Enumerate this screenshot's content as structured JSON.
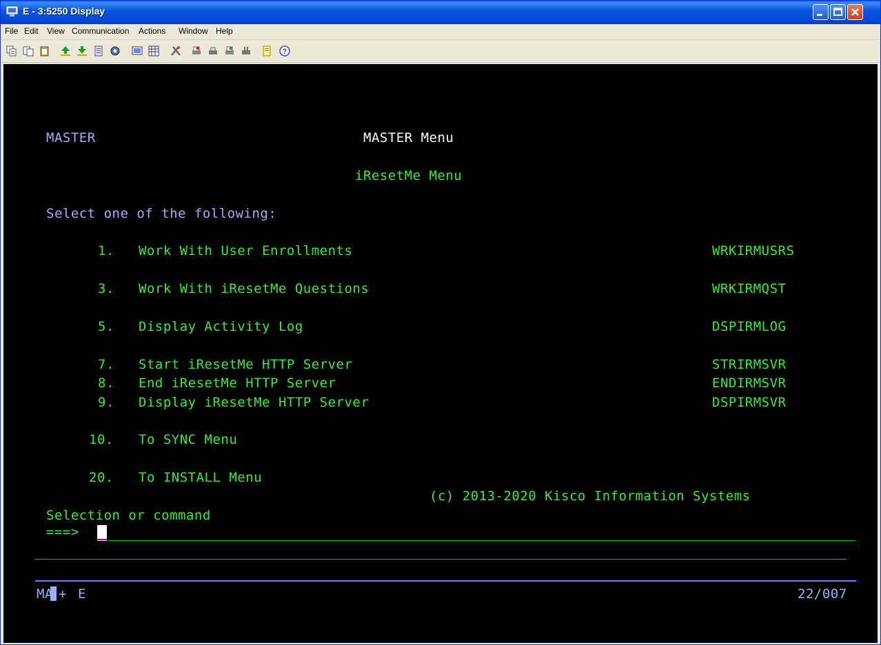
{
  "window": {
    "title": "E - 3:5250 Display"
  },
  "menubar": [
    "File",
    "Edit",
    "View",
    "Communication",
    "Actions",
    "Window",
    "Help"
  ],
  "toolbar": {
    "icons": [
      "copy-icon",
      "paste-icon",
      "clipboard-icon",
      "upload-icon",
      "download-icon",
      "macro-icon",
      "settings-icon",
      "screen-icon",
      "grid-icon",
      "tools-icon",
      "print-icon",
      "printer2-icon",
      "print3-icon",
      "printer4-icon",
      "note-icon",
      "help-icon"
    ]
  },
  "screen": {
    "system_name": "MASTER",
    "menu_title": "MASTER Menu",
    "submenu_title": "iResetMe Menu",
    "prompt": "Select one of the following:",
    "options": [
      {
        "num": "1.",
        "label": "Work With User Enrollments",
        "cmd": "WRKIRMUSRS"
      },
      {
        "num": "3.",
        "label": "Work With iResetMe Questions",
        "cmd": "WRKIRMQST"
      },
      {
        "num": "5.",
        "label": "Display Activity Log",
        "cmd": "DSPIRMLOG"
      },
      {
        "num": "7.",
        "label": "Start iResetMe HTTP Server",
        "cmd": "STRIRMSVR"
      },
      {
        "num": "8.",
        "label": "End iResetMe HTTP Server",
        "cmd": "ENDIRMSVR"
      },
      {
        "num": "9.",
        "label": "Display iResetMe HTTP Server",
        "cmd": "DSPIRMSVR"
      },
      {
        "num": "10.",
        "label": "To SYNC Menu",
        "cmd": ""
      },
      {
        "num": "20.",
        "label": "To INSTALL Menu",
        "cmd": ""
      }
    ],
    "copyright": "(c) 2013-2020 Kisco Information Systems",
    "selection_label": "Selection or command",
    "command_prompt": "===>",
    "command_value": ""
  },
  "status": {
    "left": "MA",
    "plus": "+",
    "indicator": "E",
    "position": "22/007"
  },
  "colors": {
    "terminal_bg": "#000000",
    "green": "#33ee33",
    "white": "#ffffff",
    "blue": "#9ab0ff",
    "titlebar": "#0a58e0"
  }
}
